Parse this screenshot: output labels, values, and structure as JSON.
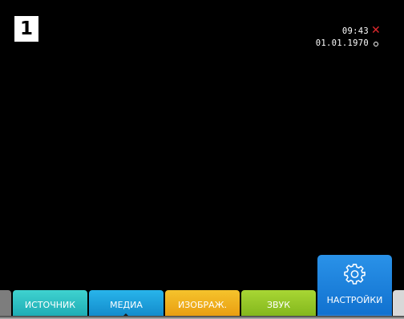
{
  "badge": {
    "step": "1"
  },
  "status": {
    "time": "09:43",
    "date": "01.01.1970",
    "alert_icon": "close-x-icon",
    "alert_color": "#e0282d",
    "indicator_icon": "ring-icon"
  },
  "menu": {
    "tabs": [
      {
        "label": "ИСТОЧНИК",
        "color": "#1aa8b2"
      },
      {
        "label": "МЕДИА",
        "color": "#1187c9"
      },
      {
        "label": "ИЗОБРАЖ.",
        "color": "#e89a0e"
      },
      {
        "label": "ЗВУК",
        "color": "#7fb41a"
      }
    ],
    "active_tab": {
      "label": "НАСТРОЙКИ",
      "icon": "gear-icon",
      "color": "#0f6fce"
    }
  }
}
